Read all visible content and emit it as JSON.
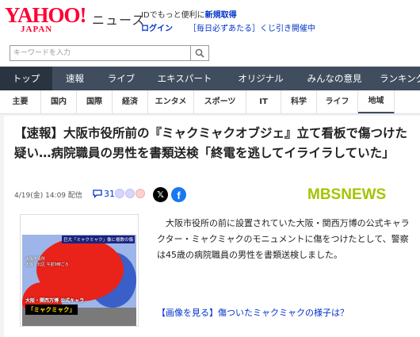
{
  "header": {
    "logo_main": "YAHOO!",
    "logo_sub": "JAPAN",
    "site_name": "ニュース",
    "promo_prefix": "IDでもっと便利に",
    "register": "新規取得",
    "login": "ログイン",
    "lottery": "［毎日必ずあたる］くじ引き開催中"
  },
  "search": {
    "placeholder": "キーワードを入力"
  },
  "main_nav": [
    {
      "label": "トップ",
      "active": true
    },
    {
      "label": "速報"
    },
    {
      "label": "ライブ"
    },
    {
      "label": "エキスパート"
    },
    {
      "label": "オリジナル"
    },
    {
      "label": "みんなの意見"
    },
    {
      "label": "ランキング"
    }
  ],
  "sub_nav": [
    {
      "label": "主要"
    },
    {
      "label": "国内"
    },
    {
      "label": "国際"
    },
    {
      "label": "経済"
    },
    {
      "label": "エンタメ"
    },
    {
      "label": "スポーツ"
    },
    {
      "label": "IT"
    },
    {
      "label": "科学"
    },
    {
      "label": "ライフ"
    },
    {
      "label": "地域",
      "active": true
    }
  ],
  "article": {
    "headline": "【速報】大阪市役所前の『ミャクミャクオブジェ』立て看板で傷つけた疑い…病院職員の男性を書類送検「終電を逃してイライラしていた」",
    "date": "4/19(金) 14:09 配信",
    "comment_count": "31",
    "source_logo_left": "MBS",
    "source_logo_right": "NEWS",
    "body": "大阪市役所の前に設置されていた大阪・関西万博の公式キャラクター・ミャクミャクのモニュメントに傷をつけたとして、警察は45歳の病院職員の男性を書類送検しました。",
    "related_link": "【画像を見る】傷ついたミャクミャクの様子は？",
    "image_overlay": {
      "banner": "巨大「ミャクミャク」像に複数の傷",
      "location_line1": "大阪市役所",
      "location_line2": "大阪・北区 午前9時ごろ",
      "caption": "大阪・関西万博 公式キャラ",
      "name_tag": "「ミャクミャク」"
    }
  }
}
